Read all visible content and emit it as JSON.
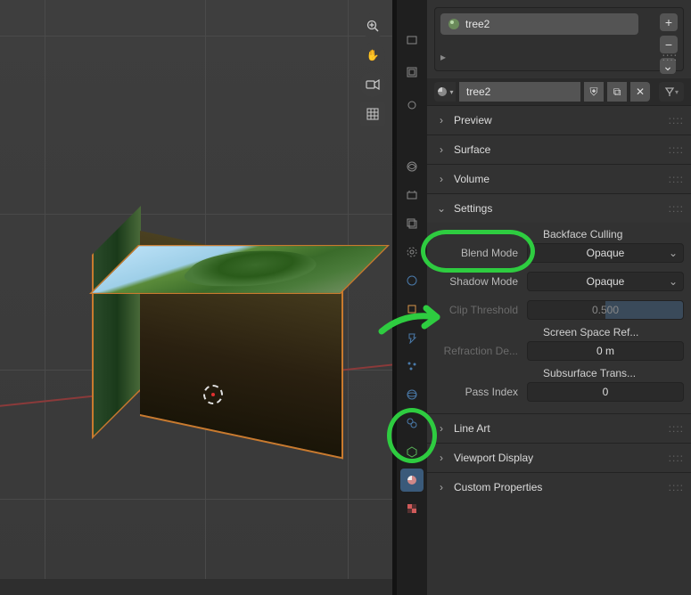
{
  "viewport": {},
  "material": {
    "slot_name": "tree2",
    "name_field": "tree2"
  },
  "panels": {
    "preview": "Preview",
    "surface": "Surface",
    "volume": "Volume",
    "settings": "Settings",
    "lineart": "Line Art",
    "viewport_display": "Viewport Display",
    "custom_properties": "Custom Properties"
  },
  "settings": {
    "backface_culling": "Backface Culling",
    "blend_mode_label": "Blend Mode",
    "blend_mode_value": "Opaque",
    "shadow_mode_label": "Shadow Mode",
    "shadow_mode_value": "Opaque",
    "clip_threshold_label": "Clip Threshold",
    "clip_threshold_value": "0.500",
    "ssr": "Screen Space Ref...",
    "refraction_label": "Refraction De...",
    "refraction_value": "0 m",
    "subsurface": "Subsurface Trans...",
    "pass_index_label": "Pass Index",
    "pass_index_value": "0"
  },
  "icons": {
    "zoom": "⊕",
    "hand": "✋",
    "camera": "🎥",
    "grid": "▦",
    "plus": "+",
    "minus": "−",
    "chevdown": "⌄",
    "shield": "⛨",
    "copy": "⧉",
    "x": "✕",
    "pin": "▿",
    "play": "▸",
    "dots": "::::"
  }
}
